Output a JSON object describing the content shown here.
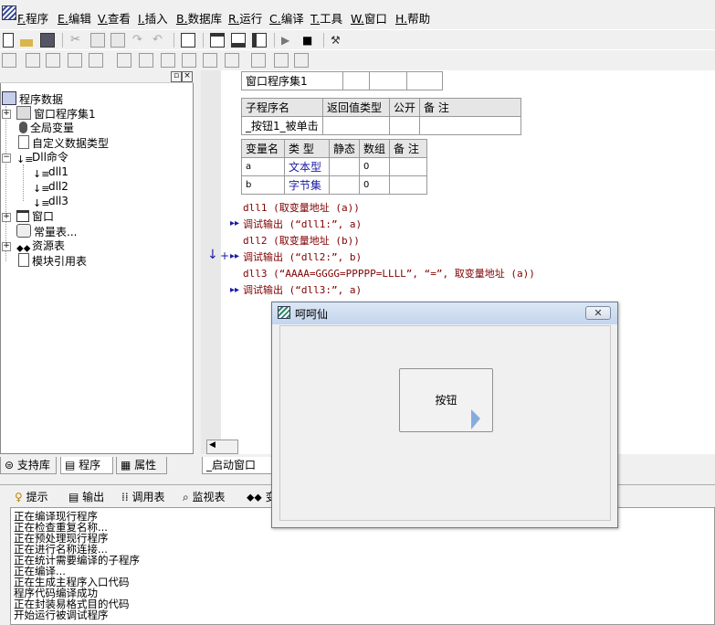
{
  "menu": [
    {
      "mnemonic": "F.",
      "label": "程序"
    },
    {
      "mnemonic": "E.",
      "label": "编辑"
    },
    {
      "mnemonic": "V.",
      "label": "查看"
    },
    {
      "mnemonic": "I.",
      "label": "插入"
    },
    {
      "mnemonic": "B.",
      "label": "数据库"
    },
    {
      "mnemonic": "R.",
      "label": "运行"
    },
    {
      "mnemonic": "C.",
      "label": "编译"
    },
    {
      "mnemonic": "T.",
      "label": "工具"
    },
    {
      "mnemonic": "W.",
      "label": "窗口"
    },
    {
      "mnemonic": "H.",
      "label": "帮助"
    }
  ],
  "tree": {
    "root": "程序数据",
    "items": [
      "窗口程序集1",
      "全局变量",
      "自定义数据类型",
      "Dll命令",
      "dll1",
      "dll2",
      "dll3",
      "窗口",
      "常量表...",
      "资源表",
      "模块引用表"
    ]
  },
  "left_tabs": [
    "支持库",
    "程序",
    "属性"
  ],
  "code_tab": "_启动窗口",
  "assembly_table": {
    "name": "窗口程序集1"
  },
  "sub_table": {
    "headers": [
      "子程序名",
      "返回值类型",
      "公开",
      "备 注"
    ],
    "row": [
      "_按钮1_被单击",
      "",
      "",
      ""
    ]
  },
  "var_table": {
    "headers": [
      "变量名",
      "类 型",
      "静态",
      "数组",
      "备 注"
    ],
    "rows": [
      [
        "a",
        "文本型",
        "",
        "0",
        ""
      ],
      [
        "b",
        "字节集",
        "",
        "0",
        ""
      ]
    ]
  },
  "code": [
    "dll1 (取变量地址 (a))",
    "调试输出 (“dll1:”, a)",
    "dll2 (取变量地址 (b))",
    "调试输出 (“dll2:”, b)",
    "dll3 (“AAAA=GGGG=PPPPP=LLLL”, “=”, 取变量地址 (a))",
    "调试输出 (“dll3:”, a)"
  ],
  "output_tabs": [
    "提示",
    "输出",
    "调用表",
    "监视表",
    "变"
  ],
  "log": [
    "正在编译现行程序",
    "正在检查重复名称...",
    "正在预处理现行程序",
    "正在进行名称连接...",
    "正在统计需要编译的子程序",
    "正在编译...",
    "正在生成主程序入口代码",
    "程序代码编译成功",
    "正在封装易格式目的代码",
    "开始运行被调试程序"
  ],
  "dialog": {
    "title": "呵呵仙",
    "button": "按钮"
  },
  "colors": {
    "code_text": "#800000",
    "type_text": "#1a1aa8",
    "dialog_title": "#c4d5ec"
  }
}
